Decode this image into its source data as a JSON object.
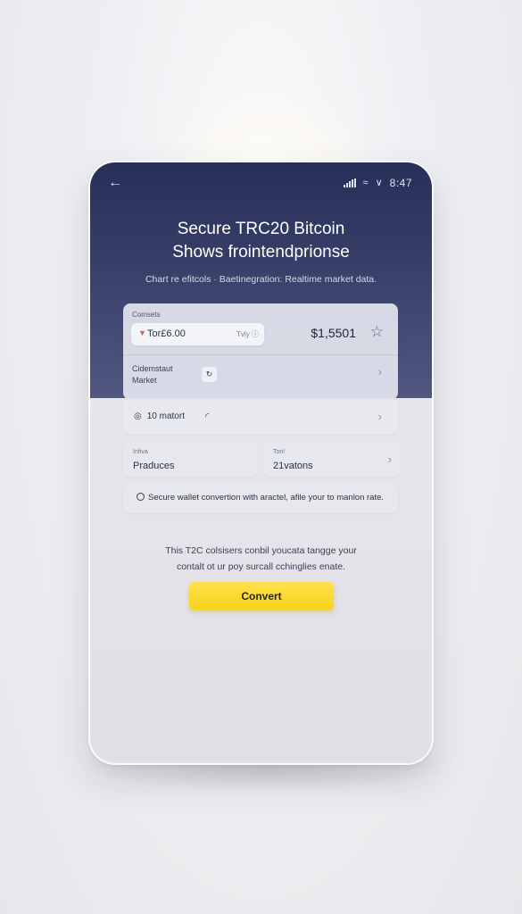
{
  "status_bar": {
    "back_icon": "back-arrow-icon",
    "time": "8:47"
  },
  "header": {
    "title_line1": "Secure TRC20 Bitcoin",
    "title_line2": "Shows frointendprionse",
    "subtitle": "Chart re efitcols · Baetinegration: Realtime market data."
  },
  "converter_card": {
    "label": "Comsets",
    "token_name": "Tor£6.00",
    "token_hint": "Tvly",
    "value": "$1,5501",
    "market_label_line1": "Cidemstaut",
    "market_label_line2": "Market"
  },
  "row": {
    "label": "10 matort"
  },
  "boxes": {
    "left_small": "Infiva",
    "left_main": "Praduces",
    "right_small": "Ton!",
    "right_main": "21vatons"
  },
  "note": {
    "text": "Secure wallet convertion with aractel, afile your to manlon rate."
  },
  "description": {
    "line1": "This T2C colsisers conbil youcata tangge your",
    "line2": "contalt ot ur poy surcall cchinglies enate."
  },
  "convert_button": {
    "label": "Convert"
  },
  "colors": {
    "header_bg": "#2b3360",
    "accent": "#f7d21a",
    "token_dot": "#e2574c"
  }
}
